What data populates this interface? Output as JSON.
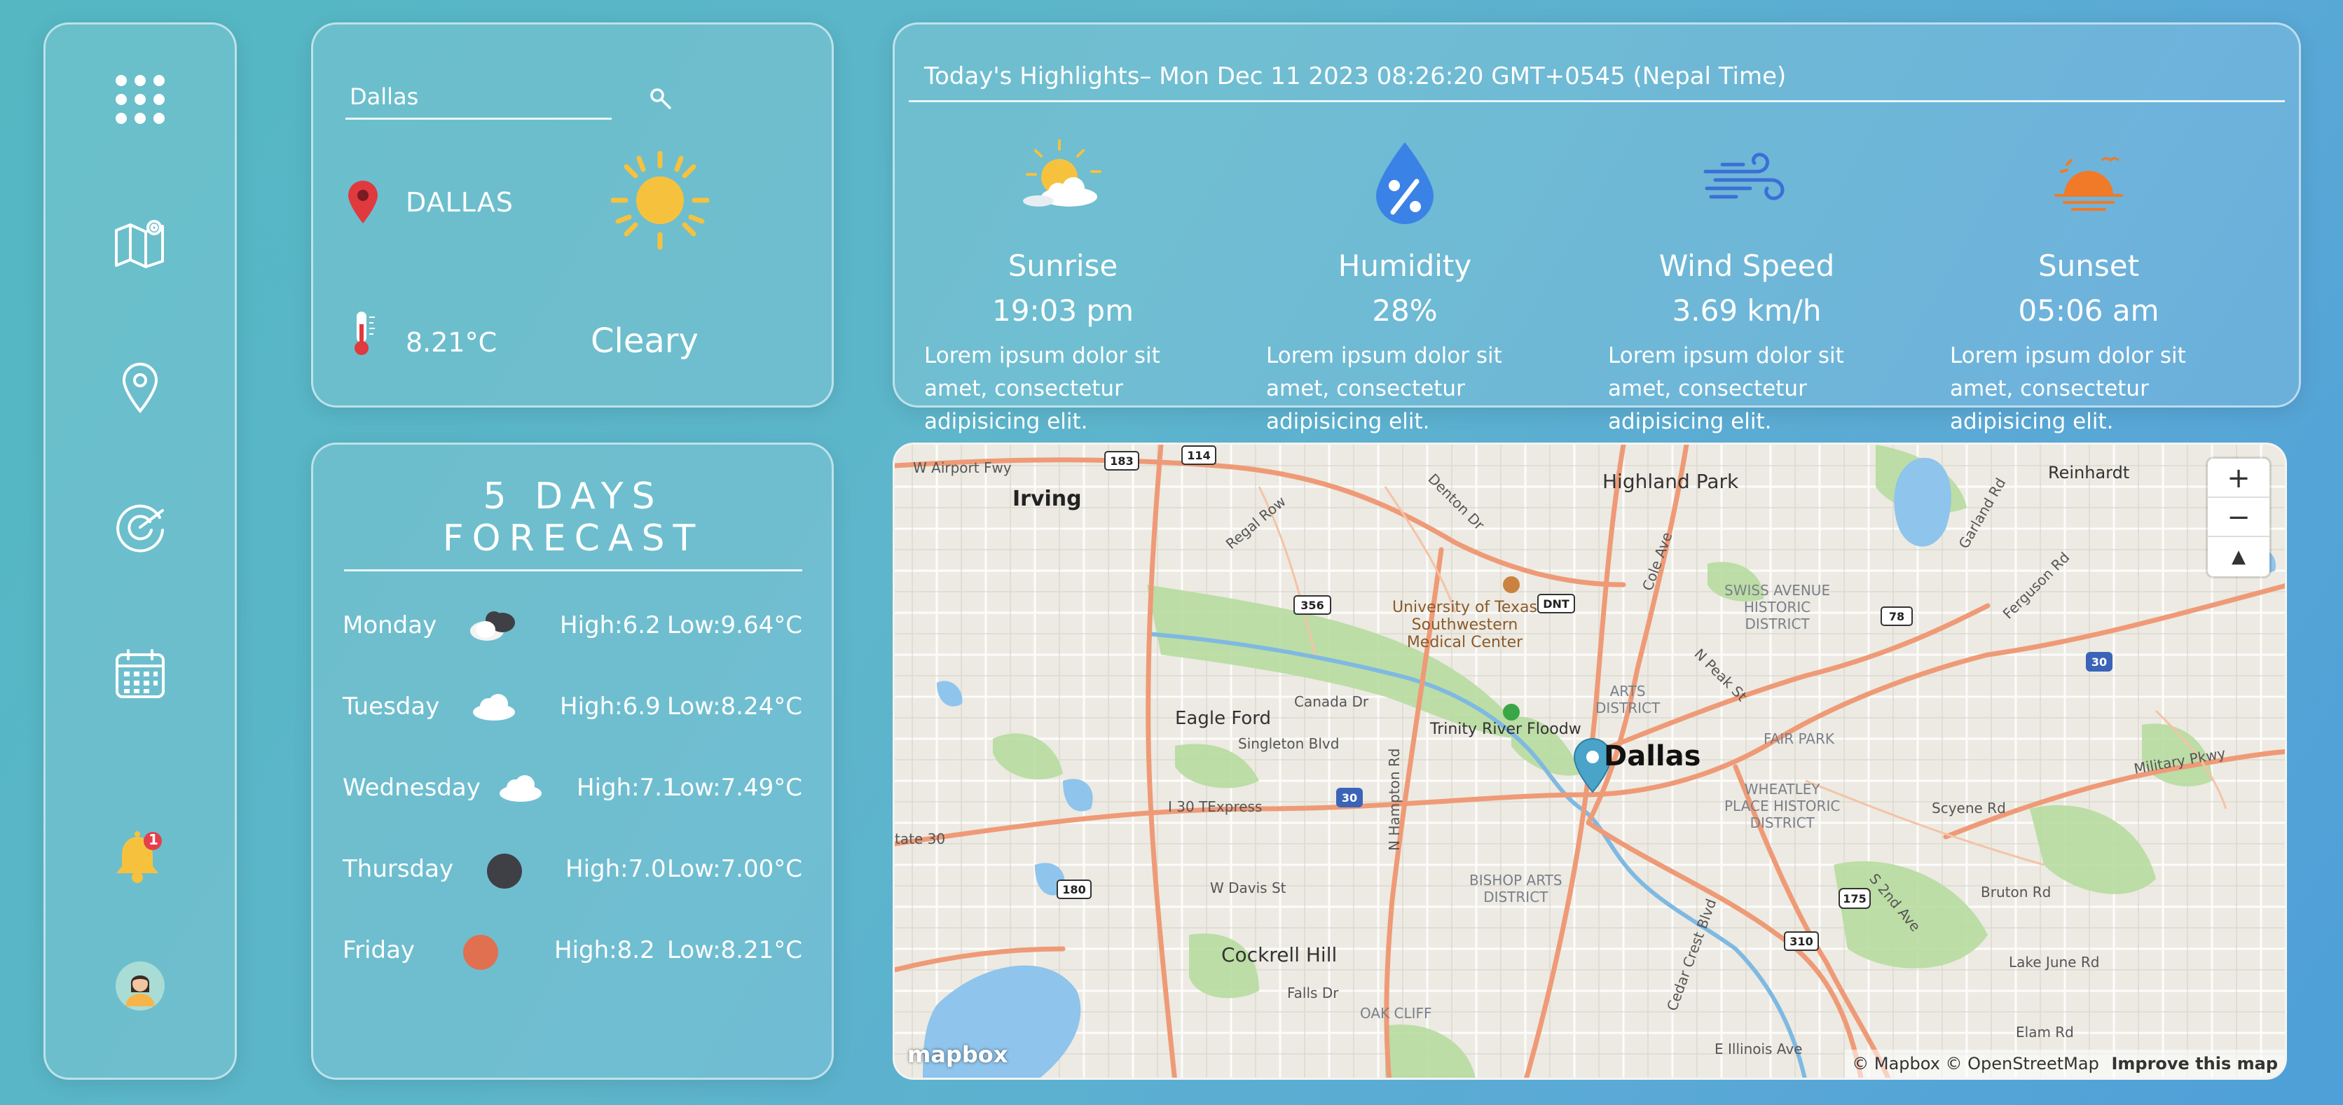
{
  "search": {
    "value": "Dallas",
    "placeholder": "Dallas"
  },
  "current": {
    "city": "DALLAS",
    "temperature": "8.21°C",
    "condition": "Cleary"
  },
  "forecast": {
    "title": "5 DAYS FORECAST",
    "days": [
      {
        "day": "Monday",
        "icon": "dark-cloud-icon",
        "high": "High:6.2",
        "low": "Low:9.64°C"
      },
      {
        "day": "Tuesday",
        "icon": "cloud-icon",
        "high": "High:6.9",
        "low": "Low:8.24°C"
      },
      {
        "day": "Wednesday",
        "icon": "cloud-icon",
        "high": "High:7.1",
        "low": "Low:7.49°C"
      },
      {
        "day": "Thursday",
        "icon": "dark-circle-icon",
        "high": "High:7.0",
        "low": "Low:7.00°C"
      },
      {
        "day": "Friday",
        "icon": "red-circle-icon",
        "high": "High:8.2",
        "low": "Low:8.21°C"
      }
    ]
  },
  "highlights": {
    "title": "Today's Highlights– Mon Dec 11 2023 08:26:20 GMT+0545 (Nepal Time)",
    "items": [
      {
        "name": "Sunrise",
        "value": "19:03 pm",
        "desc": "Lorem ipsum dolor sit amet, consectetur adipisicing elit.",
        "icon": "sun-cloud-icon"
      },
      {
        "name": "Humidity",
        "value": "28%",
        "desc": "Lorem ipsum dolor sit amet, consectetur adipisicing elit.",
        "icon": "humidity-drop-icon"
      },
      {
        "name": "Wind Speed",
        "value": "3.69 km/h",
        "desc": "Lorem ipsum dolor sit amet, consectetur adipisicing elit.",
        "icon": "wind-icon"
      },
      {
        "name": "Sunset",
        "value": "05:06 am",
        "desc": "Lorem ipsum dolor sit amet, consectetur adipisicing elit.",
        "icon": "sunset-icon"
      }
    ]
  },
  "sidebar": {
    "items": [
      {
        "icon": "apps-grid-icon"
      },
      {
        "icon": "map-icon"
      },
      {
        "icon": "location-pin-icon"
      },
      {
        "icon": "radar-icon"
      },
      {
        "icon": "calendar-icon"
      },
      {
        "icon": "notification-bell-icon",
        "badge": "1"
      },
      {
        "icon": "user-avatar-icon"
      }
    ]
  },
  "map": {
    "labels": {
      "irving": "Irving",
      "highland_park": "Highland Park",
      "reinhardt": "Reinhardt",
      "eagle_ford": "Eagle Ford",
      "dallas": "Dallas",
      "cockrell_hill": "Cockrell Hill",
      "utsw": "University of Texas\nSouthwestern\nMedical Center",
      "trinity": "Trinity River Floodw",
      "swiss": "SWISS AVENUE\nHISTORIC\nDISTRICT",
      "arts": "ARTS\nDISTRICT",
      "fair_park": "FAIR PARK",
      "wheatley": "WHEATLEY\nPLACE HISTORIC\nDISTRICT",
      "bishop": "BISHOP ARTS\nDISTRICT",
      "oak_cliff": "OAK CLIFF",
      "w_airport": "W Airport Fwy",
      "regal_row": "Regal Row",
      "canada_dr": "Canada Dr",
      "singleton": "Singleton Blvd",
      "i30_tex": "I 30 TExpress",
      "w_davis": "W Davis St",
      "falls_dr": "Falls Dr",
      "military": "Military Pkwy",
      "scyene": "Scyene Rd",
      "bruton": "Bruton Rd",
      "lake_june": "Lake June Rd",
      "elam": "Elam Rd",
      "e_illinois": "E Illinois Ave",
      "ferguson": "Ferguson Rd",
      "n_peak": "N Peak St",
      "s_2nd": "S 2nd Ave",
      "cedar_crest": "Cedar Crest Blvd",
      "n_hampton": "N Hampton Rd",
      "denton": "Denton Dr",
      "cole": "Cole Ave",
      "garland": "Garland Rd",
      "state30": "tate 30"
    },
    "shields": [
      "183",
      "114",
      "356",
      "DNT",
      "78",
      "30",
      "30",
      "180",
      "175",
      "310"
    ],
    "zoom_in": "+",
    "zoom_out": "−",
    "compass": "▲",
    "logo": "mapbox",
    "attribution": "© Mapbox © OpenStreetMap",
    "improve": "Improve this map"
  },
  "colors": {
    "accent_bg_start": "#54b7c2",
    "accent_bg_end": "#4f9fd8",
    "pin_red": "#e0393e",
    "sun_yellow": "#f6c23e",
    "friday_dot": "#e0704f",
    "map_pin": "#4aa3c9"
  }
}
